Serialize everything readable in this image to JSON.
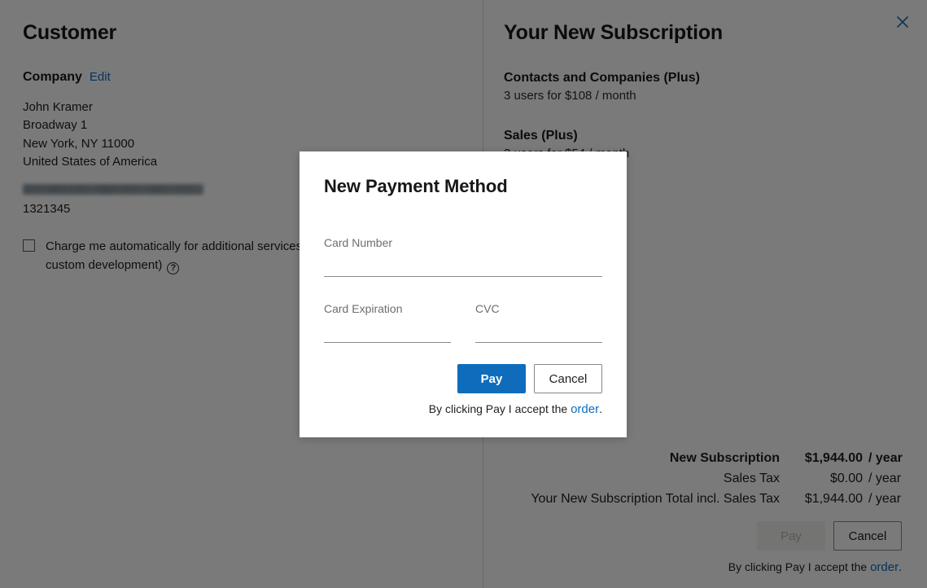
{
  "customer": {
    "heading": "Customer",
    "company_label": "Company",
    "edit_link": "Edit",
    "address": [
      "John Kramer",
      "Broadway 1",
      "New York, NY 11000",
      "United States of America"
    ],
    "customer_id": "1321345",
    "auto_charge_text": "Charge me automatically for additional services (e.g. custom development)",
    "help_icon_glyph": "?"
  },
  "subscription": {
    "heading": "Your New Subscription",
    "items": [
      {
        "name": "Contacts and Companies (Plus)",
        "detail": "3 users for $108 / month"
      },
      {
        "name": "Sales (Plus)",
        "detail": "3 users for $54 / month"
      }
    ],
    "summary": [
      {
        "label": "New Subscription",
        "amount": "$1,944.00",
        "period": "/ year",
        "bold": true
      },
      {
        "label": "Sales Tax",
        "amount": "$0.00",
        "period": "/ year",
        "bold": false
      },
      {
        "label": "Your New Subscription Total incl. Sales Tax",
        "amount": "$1,944.00",
        "period": "/ year",
        "bold": false
      }
    ],
    "pay_label": "Pay",
    "cancel_label": "Cancel",
    "accept_prefix": "By clicking Pay I accept the ",
    "accept_link": "order",
    "accept_suffix": "."
  },
  "close_icon": "close-icon",
  "modal": {
    "title": "New Payment Method",
    "card_number_label": "Card Number",
    "card_number_value": "",
    "card_number_placeholder": "",
    "card_expiration_label": "Card Expiration",
    "card_expiration_value": "",
    "card_expiration_placeholder": "",
    "cvc_label": "CVC",
    "cvc_value": "",
    "cvc_placeholder": "",
    "pay_label": "Pay",
    "cancel_label": "Cancel",
    "accept_prefix": "By clicking Pay I accept the ",
    "accept_link": "order",
    "accept_suffix": "."
  },
  "colors": {
    "accent": "#0f6cbd",
    "overlay": "#7a7a7a",
    "text": "#1f1f1f",
    "muted": "#6e6e6e"
  }
}
